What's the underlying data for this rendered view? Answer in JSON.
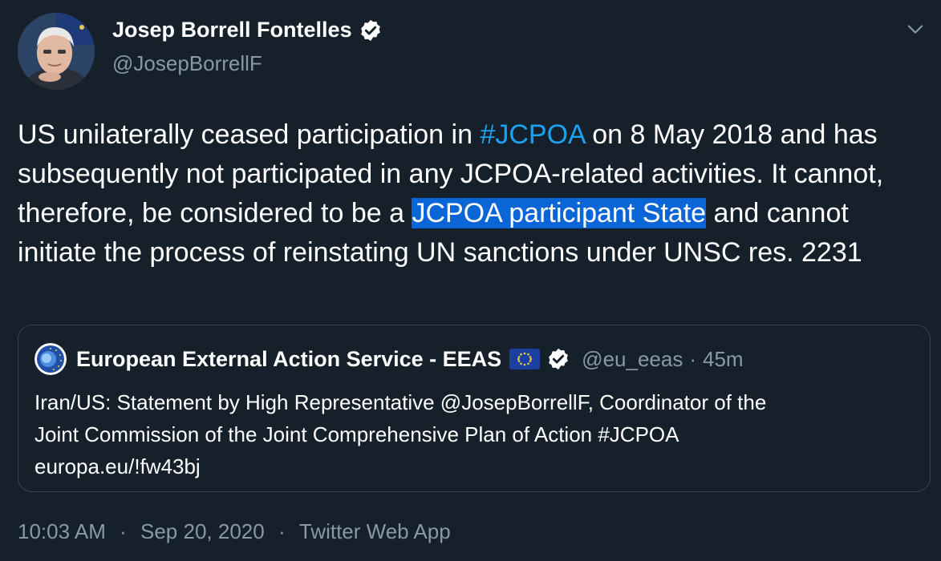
{
  "author": {
    "display_name": "Josep Borrell Fontelles",
    "handle": "@JosepBorrellF",
    "verified": true
  },
  "menu": {
    "icon": "chevron-down-icon"
  },
  "tweet": {
    "segments": [
      {
        "text": "US unilaterally ceased participation in ",
        "style": "plain"
      },
      {
        "text": "#JCPOA",
        "style": "hashtag"
      },
      {
        "text": " on 8 May 2018 and has subsequently not participated in any JCPOA-related activities. It cannot, therefore, be considered to be a ",
        "style": "plain"
      },
      {
        "text": "JCPOA participant State",
        "style": "selected"
      },
      {
        "text": " and cannot initiate the process of reinstating UN sanctions under UNSC res. 2231",
        "style": "plain"
      }
    ]
  },
  "quote": {
    "display_name": "European External Action Service - EEAS",
    "flag_icon": "eu-flag-icon",
    "verified": true,
    "handle": "@eu_eeas",
    "separator": "·",
    "time": "45m",
    "text_lines": [
      "Iran/US: Statement by High Representative @JosepBorrellF, Coordinator of the",
      "Joint Commission of the Joint Comprehensive Plan of Action #JCPOA",
      "europa.eu/!fw43bj"
    ]
  },
  "meta": {
    "time": "10:03 AM",
    "separator": "·",
    "date": "Sep 20, 2020",
    "source": "Twitter Web App"
  },
  "colors": {
    "background": "#15202b",
    "hashtag": "#1da1f2",
    "selection": "#0a66d6",
    "secondary_text": "#8899a6",
    "border": "#38444d"
  }
}
